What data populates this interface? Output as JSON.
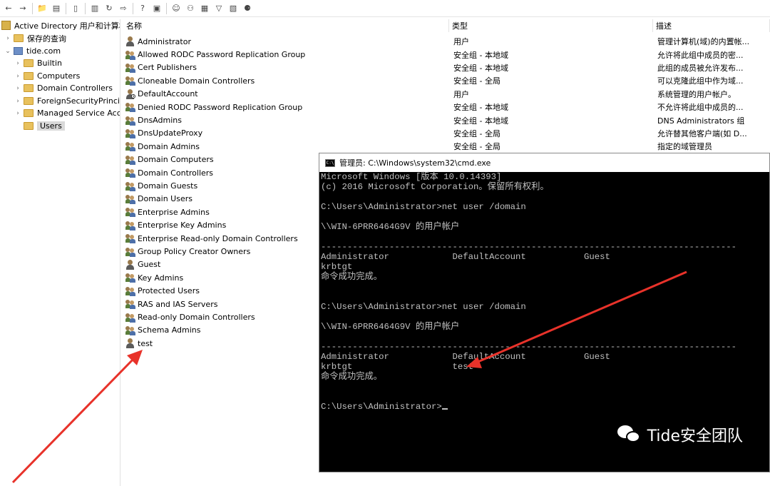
{
  "toolbar": {
    "icons": [
      "back-icon",
      "forward-icon",
      "up-folder-icon",
      "details-view-icon",
      "delete-icon",
      "properties-icon",
      "refresh-icon",
      "export-icon",
      "help-icon",
      "console-icon",
      "users-icon",
      "groups-icon",
      "ou-icon",
      "filter-icon",
      "find-icon",
      "add-to-group-icon"
    ]
  },
  "tree": {
    "root": "Active Directory 用户和计算机",
    "saved_queries": "保存的查询",
    "domain": "tide.com",
    "children": [
      "Builtin",
      "Computers",
      "Domain Controllers",
      "ForeignSecurityPrincipals",
      "Managed Service Accounts",
      "Users"
    ],
    "selected": "Users"
  },
  "list": {
    "headers": {
      "name": "名称",
      "type": "类型",
      "desc": "描述"
    },
    "rows": [
      {
        "name": "Administrator",
        "icon": "user",
        "type": "用户",
        "desc": "管理计算机(域)的内置帐..."
      },
      {
        "name": "Allowed RODC Password Replication Group",
        "icon": "group",
        "type": "安全组 - 本地域",
        "desc": "允许将此组中成员的密..."
      },
      {
        "name": "Cert Publishers",
        "icon": "group",
        "type": "安全组 - 本地域",
        "desc": "此组的成员被允许发布..."
      },
      {
        "name": "Cloneable Domain Controllers",
        "icon": "group",
        "type": "安全组 - 全局",
        "desc": "可以克隆此组中作为域..."
      },
      {
        "name": "DefaultAccount",
        "icon": "user-disabled",
        "type": "用户",
        "desc": "系统管理的用户帐户。"
      },
      {
        "name": "Denied RODC Password Replication Group",
        "icon": "group",
        "type": "安全组 - 本地域",
        "desc": "不允许将此组中成员的..."
      },
      {
        "name": "DnsAdmins",
        "icon": "group",
        "type": "安全组 - 本地域",
        "desc": "DNS Administrators 组"
      },
      {
        "name": "DnsUpdateProxy",
        "icon": "group",
        "type": "安全组 - 全局",
        "desc": "允许替其他客户端(如 D..."
      },
      {
        "name": "Domain Admins",
        "icon": "group",
        "type": "安全组 - 全局",
        "desc": "指定的域管理员"
      },
      {
        "name": "Domain Computers",
        "icon": "group",
        "type": "",
        "desc": ""
      },
      {
        "name": "Domain Controllers",
        "icon": "group",
        "type": "",
        "desc": ""
      },
      {
        "name": "Domain Guests",
        "icon": "group",
        "type": "",
        "desc": ""
      },
      {
        "name": "Domain Users",
        "icon": "group",
        "type": "",
        "desc": ""
      },
      {
        "name": "Enterprise Admins",
        "icon": "group",
        "type": "",
        "desc": ""
      },
      {
        "name": "Enterprise Key Admins",
        "icon": "group",
        "type": "",
        "desc": ""
      },
      {
        "name": "Enterprise Read-only Domain Controllers",
        "icon": "group",
        "type": "",
        "desc": ""
      },
      {
        "name": "Group Policy Creator Owners",
        "icon": "group",
        "type": "",
        "desc": ""
      },
      {
        "name": "Guest",
        "icon": "user",
        "type": "",
        "desc": ""
      },
      {
        "name": "Key Admins",
        "icon": "group",
        "type": "",
        "desc": ""
      },
      {
        "name": "Protected Users",
        "icon": "group",
        "type": "",
        "desc": ""
      },
      {
        "name": "RAS and IAS Servers",
        "icon": "group",
        "type": "",
        "desc": ""
      },
      {
        "name": "Read-only Domain Controllers",
        "icon": "group",
        "type": "",
        "desc": ""
      },
      {
        "name": "Schema Admins",
        "icon": "group",
        "type": "",
        "desc": ""
      },
      {
        "name": "test",
        "icon": "user",
        "type": "",
        "desc": ""
      }
    ]
  },
  "cmd": {
    "title": "管理员: C:\\Windows\\system32\\cmd.exe",
    "icon_text": "C:\\",
    "lines": [
      "Microsoft Windows [版本 10.0.14393]",
      "(c) 2016 Microsoft Corporation。保留所有权利。",
      "",
      "C:\\Users\\Administrator>net user /domain",
      "",
      "\\\\WIN-6PRR6464G9V 的用户帐户",
      "",
      "-------------------------------------------------------------------------------",
      "Administrator            DefaultAccount           Guest",
      "krbtgt",
      "命令成功完成。",
      "",
      "",
      "C:\\Users\\Administrator>net user /domain",
      "",
      "\\\\WIN-6PRR6464G9V 的用户帐户",
      "",
      "-------------------------------------------------------------------------------",
      "Administrator            DefaultAccount           Guest",
      "krbtgt                   test",
      "命令成功完成。",
      "",
      "",
      "C:\\Users\\Administrator>"
    ]
  },
  "watermark": "Tide安全团队",
  "colors": {
    "arrow": "#e8322a",
    "selected": "#d9d9d9",
    "console_text": "#c0c0c0",
    "console_bg": "#000000"
  }
}
